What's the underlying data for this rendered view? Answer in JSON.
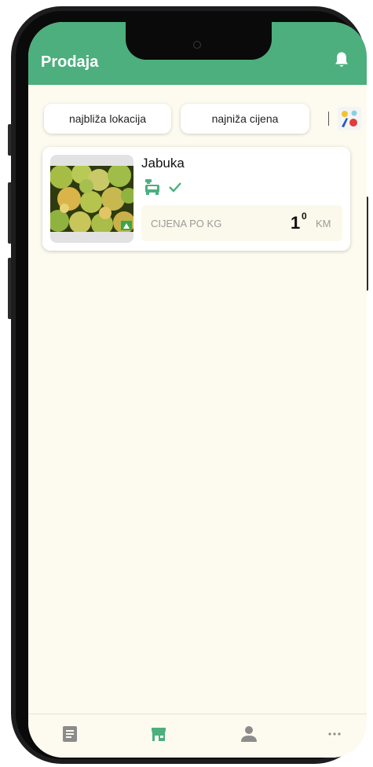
{
  "header": {
    "title": "Prodaja",
    "bell_icon": "bell-icon"
  },
  "filters": {
    "nearest_label": "najbliža lokacija",
    "lowest_price_label": "najniža cijena",
    "color_icon": "palette-icon"
  },
  "products": [
    {
      "name": "Jabuka",
      "image": "apples-photo",
      "delivery_icon": "delivery-truck-icon",
      "status_icon": "check-icon",
      "price_label": "CIJENA PO KG",
      "price_whole": "1",
      "price_fraction": "0",
      "currency": "KM"
    }
  ],
  "bottom_nav": {
    "items": [
      "list-icon",
      "store-icon",
      "person-icon",
      "more-icon"
    ],
    "active_index": 1
  },
  "colors": {
    "primary": "#4caf7d",
    "background": "#fdfbef",
    "inactive": "#8c8c8c"
  }
}
